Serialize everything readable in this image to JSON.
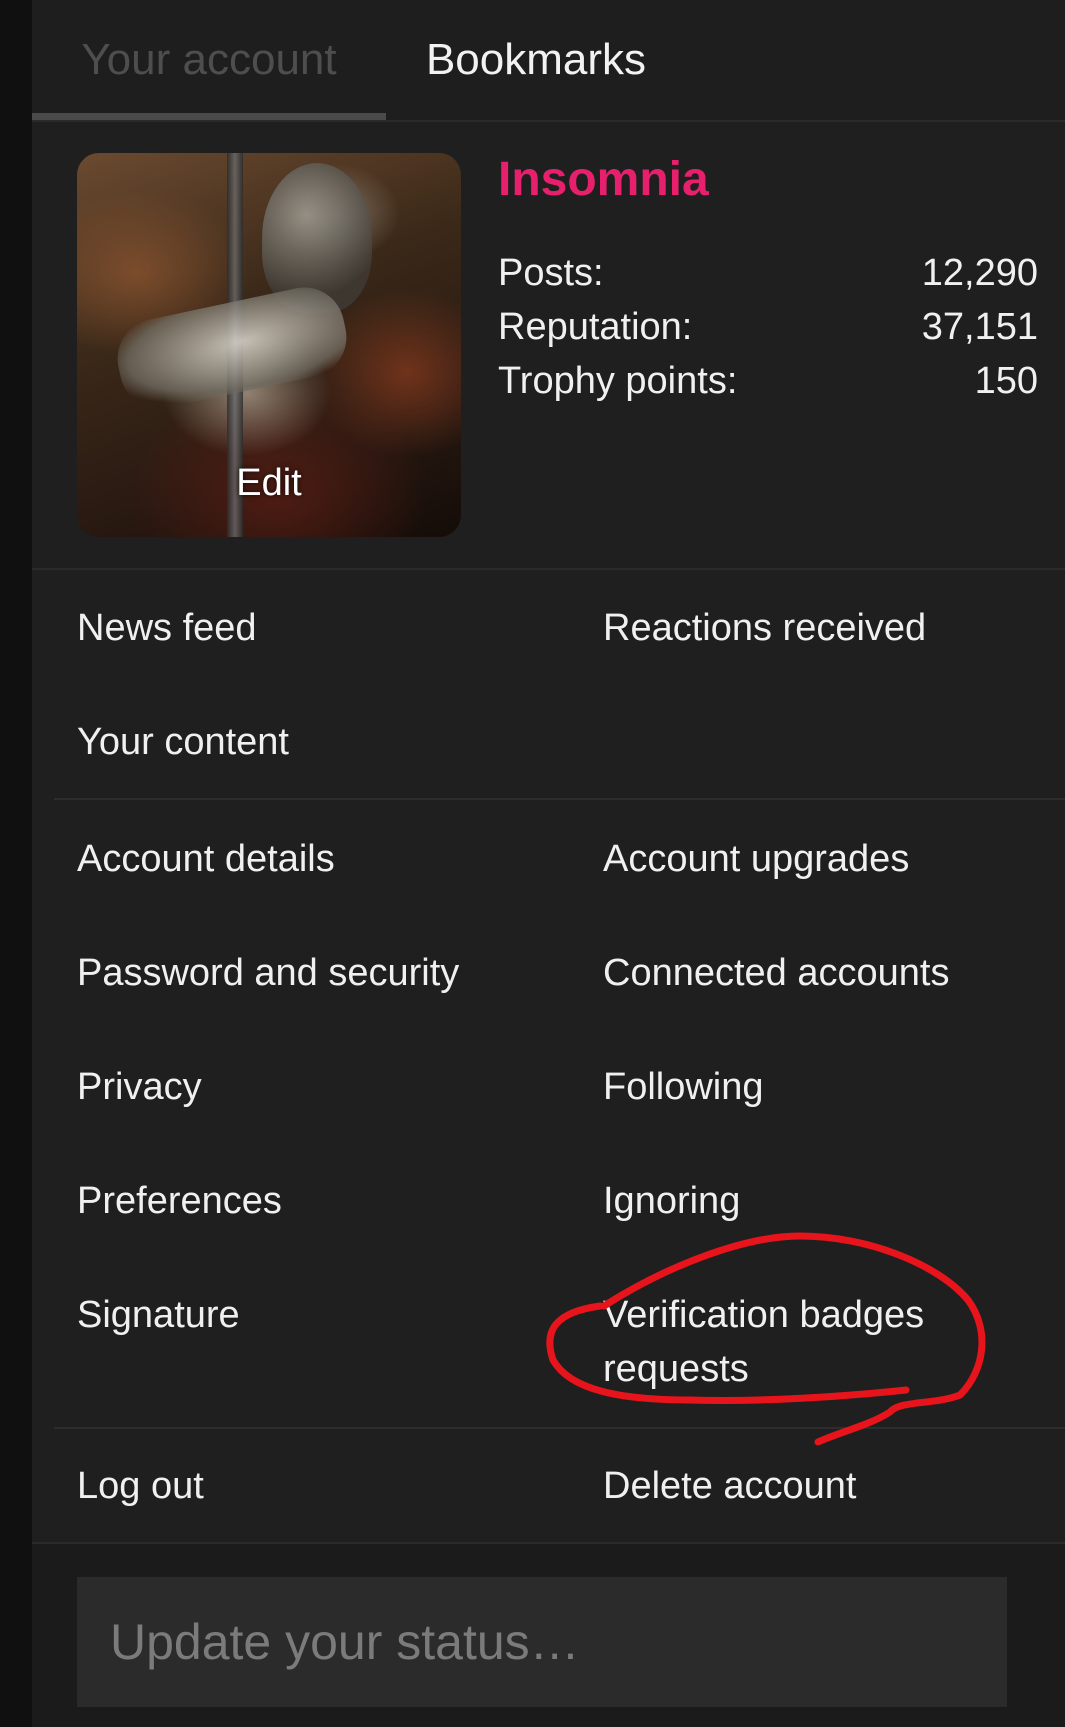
{
  "tabs": [
    {
      "label": "Your account",
      "active": true
    },
    {
      "label": "Bookmarks",
      "active": false
    }
  ],
  "profile": {
    "username": "Insomnia",
    "username_color": "#e6206c",
    "avatar_edit_label": "Edit",
    "stats": [
      {
        "label": "Posts:",
        "value": "12,290"
      },
      {
        "label": "Reputation:",
        "value": "37,151"
      },
      {
        "label": "Trophy points:",
        "value": "150"
      }
    ]
  },
  "menu": {
    "section1": {
      "left": [
        "News feed",
        "Your content"
      ],
      "right": [
        "Reactions received"
      ]
    },
    "section2": {
      "left": [
        "Account details",
        "Password and security",
        "Privacy",
        "Preferences",
        "Signature"
      ],
      "right": [
        "Account upgrades",
        "Connected accounts",
        "Following",
        "Ignoring",
        "Verification badges requests"
      ]
    },
    "section3": {
      "left": [
        "Log out"
      ],
      "right": [
        "Delete account"
      ]
    }
  },
  "status": {
    "placeholder": "Update your status…"
  },
  "annotation": {
    "color": "#e8141c",
    "target": "Verification badges requests"
  }
}
